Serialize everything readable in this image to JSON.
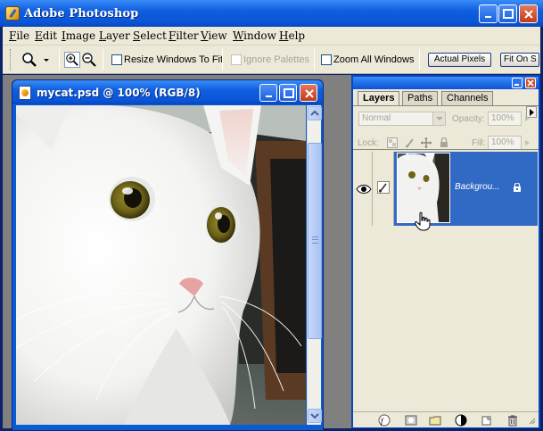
{
  "app": {
    "title": "Adobe Photoshop"
  },
  "menu": [
    "File",
    "Edit",
    "Image",
    "Layer",
    "Select",
    "Filter",
    "View",
    "Window",
    "Help"
  ],
  "options_bar": {
    "resize_windows_to_fit": "Resize Windows To Fit",
    "ignore_palettes": "Ignore Palettes",
    "zoom_all_windows": "Zoom All Windows",
    "actual_pixels": "Actual Pixels",
    "fit_on_screen": "Fit On S"
  },
  "document": {
    "title": "mycat.psd @ 100% (RGB/8)"
  },
  "layers_palette": {
    "tabs": [
      "Layers",
      "Paths",
      "Channels"
    ],
    "blend_mode": "Normal",
    "opacity_label": "Opacity:",
    "opacity_value": "100%",
    "lock_label": "Lock:",
    "fill_label": "Fill:",
    "fill_value": "100%",
    "layer_name": "Backgrou..."
  }
}
